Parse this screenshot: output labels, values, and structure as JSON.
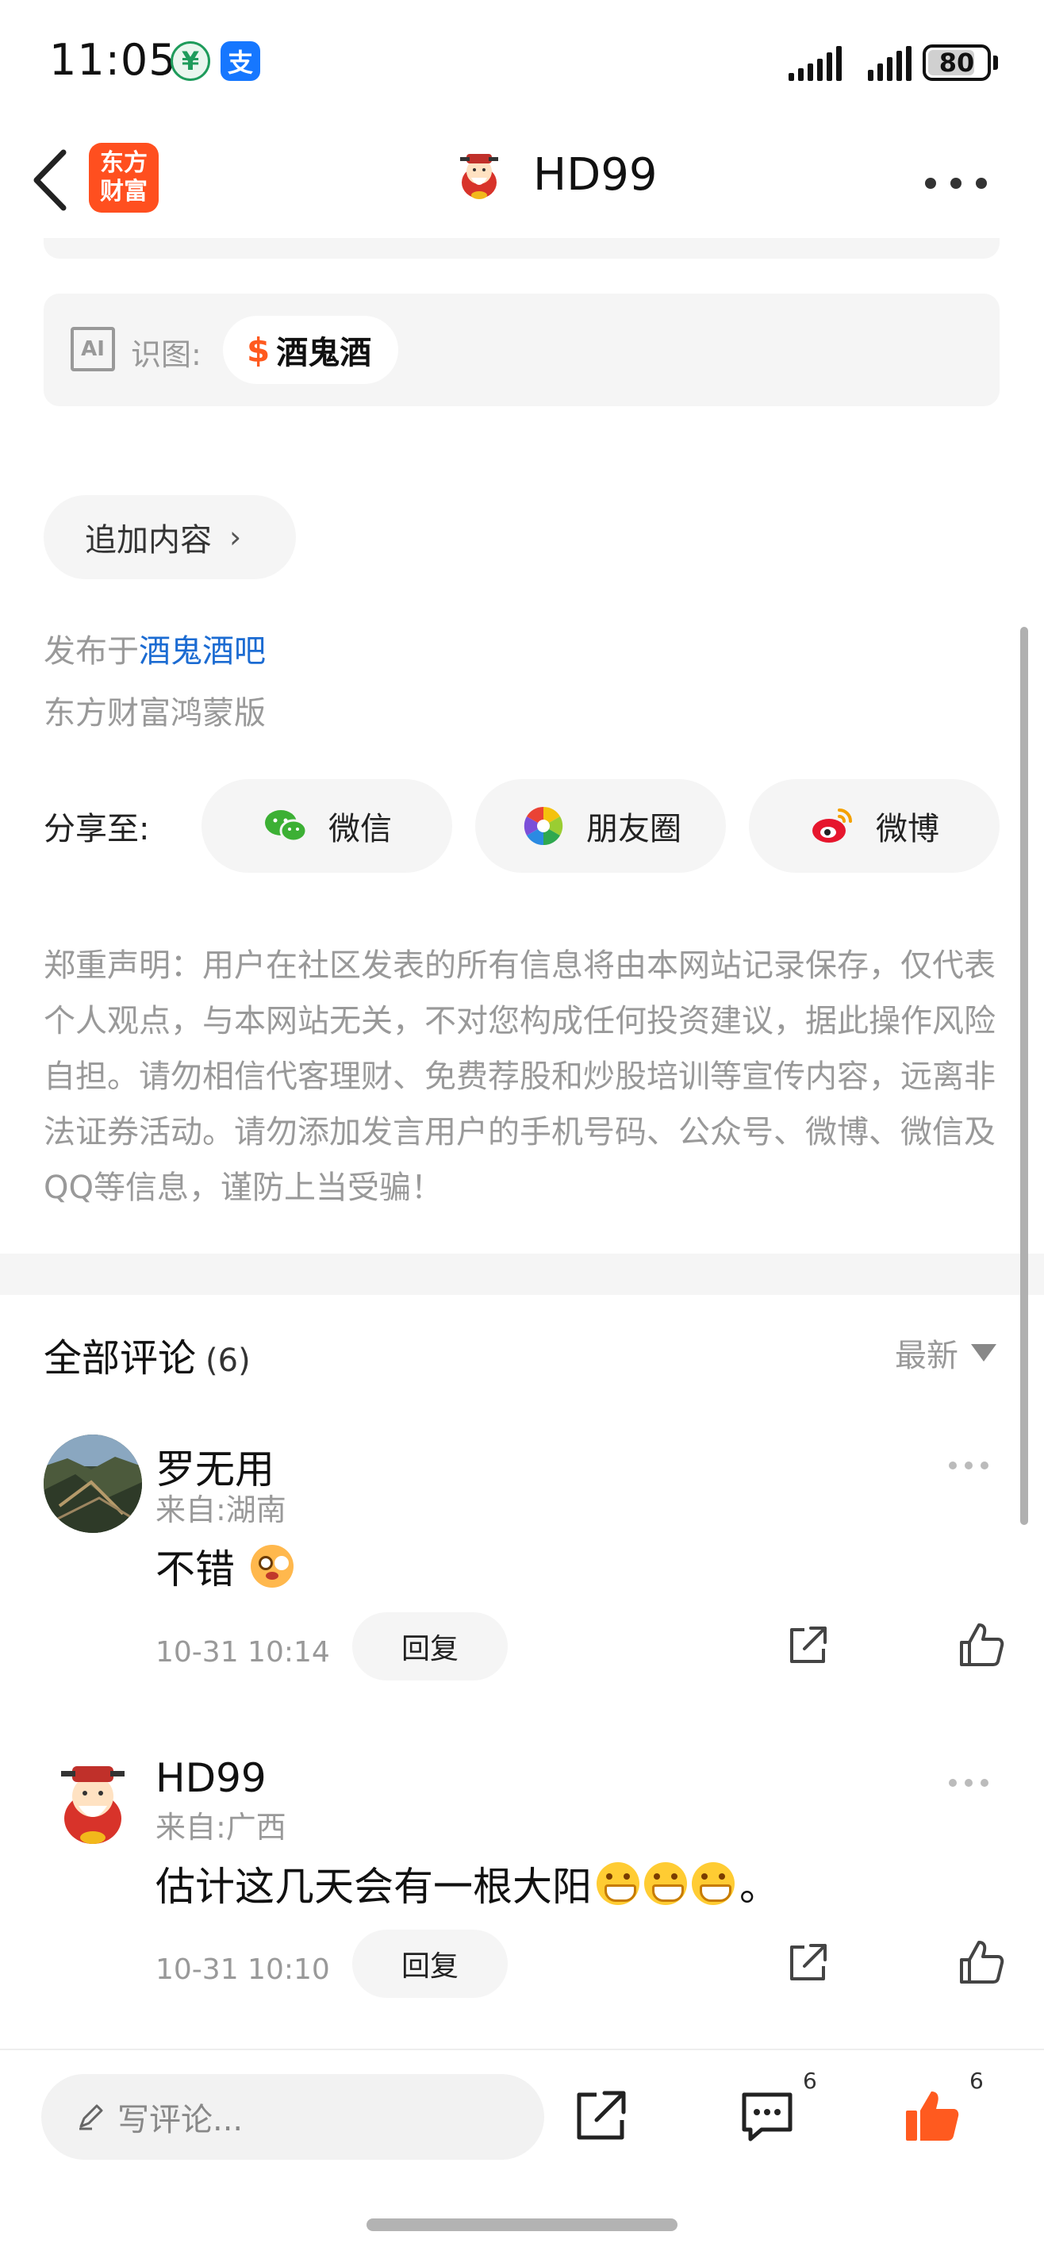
{
  "status_bar": {
    "time": "11:05",
    "battery": "80",
    "battery_level": 0.8,
    "app_icons": [
      "bank-app-icon",
      "alipay-icon"
    ]
  },
  "nav": {
    "brand_line1": "东方",
    "brand_line2": "财富",
    "title": "HD99"
  },
  "ai_recognition": {
    "label": "识图:",
    "icon_text": "AI",
    "stock_symbol": "$",
    "stock_name": "酒鬼酒"
  },
  "append_button": {
    "label": "追加内容",
    "chevron": "›"
  },
  "post_info": {
    "published_prefix": "发布于",
    "bar_name": "酒鬼酒吧",
    "platform": "东方财富鸿蒙版"
  },
  "share": {
    "label": "分享至:",
    "targets": [
      {
        "label": "微信",
        "icon": "wechat-icon"
      },
      {
        "label": "朋友圈",
        "icon": "moments-icon"
      },
      {
        "label": "微博",
        "icon": "weibo-icon"
      }
    ]
  },
  "disclaimer": "郑重声明：用户在社区发表的所有信息将由本网站记录保存，仅代表个人观点，与本网站无关，不对您构成任何投资建议，据此操作风险自担。请勿相信代客理财、免费荐股和炒股培训等宣传内容，远离非法证券活动。请勿添加发言用户的手机号码、公众号、微博、微信及QQ等信息，谨防上当受骗！",
  "comments_section": {
    "title": "全部评论",
    "count": "(6)",
    "sort_label": "最新",
    "reply_label": "回复",
    "items": [
      {
        "name": "罗无用",
        "location": "来自:湖南",
        "text": "不错",
        "emojis": [
          "flushed-face-emoji"
        ],
        "time": "10-31 10:14"
      },
      {
        "name": "HD99",
        "location": "来自:广西",
        "text": "估计这几天会有一根大阳",
        "emojis": [
          "grinning-face-emoji",
          "grinning-face-emoji",
          "grinning-face-emoji"
        ],
        "suffix": "。",
        "time": "10-31 10:10"
      }
    ]
  },
  "bottom_bar": {
    "input_placeholder": "写评论...",
    "comment_count": "6",
    "like_count": "6",
    "accent_color": "#ff5a1f"
  }
}
